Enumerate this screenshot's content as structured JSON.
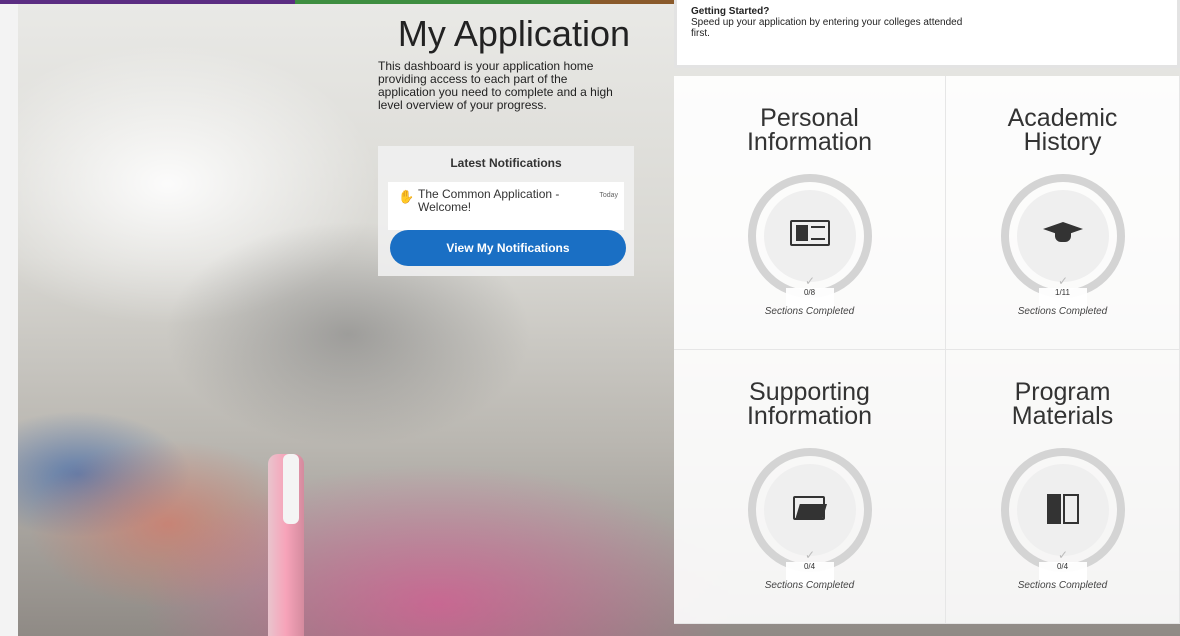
{
  "topbar_colors": [
    "#5b2d82",
    "#3e8e41",
    "#8a5a2b",
    "#1a6fc4"
  ],
  "intro": {
    "title": "My Application",
    "description": "This dashboard is your application home providing access to each part of the application you need to complete and a high level overview of your progress."
  },
  "notifications": {
    "heading": "Latest Notifications",
    "items": [
      {
        "text": "The Common Application - Welcome!",
        "date": "Today",
        "icon": "hand-wave-icon"
      }
    ],
    "button_label": "View My Notifications"
  },
  "getting_started": {
    "title": "Getting Started?",
    "text": "Speed up your application by entering your colleges attended first."
  },
  "cards": [
    {
      "title_line1": "Personal",
      "title_line2": "Information",
      "icon": "id-card-icon",
      "progress": "0/8",
      "sections_label": "Sections Completed"
    },
    {
      "title_line1": "Academic",
      "title_line2": "History",
      "icon": "graduation-cap-icon",
      "progress": "1/11",
      "sections_label": "Sections Completed"
    },
    {
      "title_line1": "Supporting",
      "title_line2": "Information",
      "icon": "folder-icon",
      "progress": "0/4",
      "sections_label": "Sections Completed"
    },
    {
      "title_line1": "Program",
      "title_line2": "Materials",
      "icon": "book-icon",
      "progress": "0/4",
      "sections_label": "Sections Completed"
    }
  ]
}
